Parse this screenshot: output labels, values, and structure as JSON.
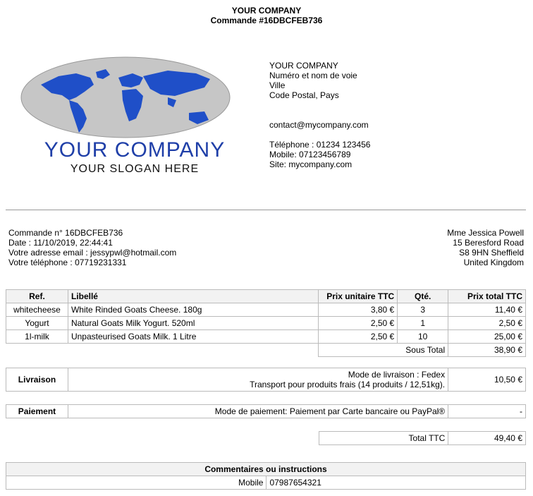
{
  "header": {
    "company": "YOUR COMPANY",
    "order_title": "Commande #16DBCFEB736"
  },
  "logo": {
    "name": "YOUR COMPANY",
    "slogan": "YOUR SLOGAN HERE",
    "color": "#1f3fa8"
  },
  "company": {
    "name": "YOUR COMPANY",
    "street": "Numéro et nom de voie",
    "city": "Ville",
    "postal": "Code Postal, Pays",
    "email": "contact@mycompany.com",
    "phone": "Téléphone : 01234 123456",
    "mobile": "Mobile: 07123456789",
    "site": "Site: mycompany.com"
  },
  "order": {
    "number": "Commande n° 16DBCFEB736",
    "date": "Date : 11/10/2019, 22:44:41",
    "email": "Votre adresse email : jessypwl@hotmail.com",
    "phone": "Votre téléphone : 07719231331"
  },
  "customer": {
    "name": "Mme Jessica Powell",
    "street": "15 Beresford Road",
    "city": "S8 9HN Sheffield",
    "country": "United Kingdom"
  },
  "items": {
    "headers": {
      "ref": "Ref.",
      "label": "Libellé",
      "unit": "Prix unitaire TTC",
      "qty": "Qté.",
      "total": "Prix total TTC"
    },
    "rows": [
      {
        "ref": "whitecheese",
        "label": "White Rinded Goats Cheese. 180g",
        "unit": "3,80 €",
        "qty": "3",
        "total": "11,40 €"
      },
      {
        "ref": "Yogurt",
        "label": "Natural Goats Milk Yogurt. 520ml",
        "unit": "2,50 €",
        "qty": "1",
        "total": "2,50 €"
      },
      {
        "ref": "1l-milk",
        "label": "Unpasteurised Goats Milk. 1 Litre",
        "unit": "2,50 €",
        "qty": "10",
        "total": "25,00 €"
      }
    ],
    "subtotal_label": "Sous Total",
    "subtotal": "38,90 €"
  },
  "shipping": {
    "label": "Livraison",
    "mode": "Mode de livraison : Fedex",
    "detail": "Transport pour produits frais (14 produits / 12,51kg).",
    "amount": "10,50 €"
  },
  "payment": {
    "label": "Paiement",
    "mode": "Mode de paiement: Paiement par Carte bancaire ou PayPal®",
    "amount": "-"
  },
  "total": {
    "label": "Total TTC",
    "amount": "49,40 €"
  },
  "comments": {
    "title": "Commentaires ou instructions",
    "key": "Mobile",
    "value": "07987654321"
  }
}
